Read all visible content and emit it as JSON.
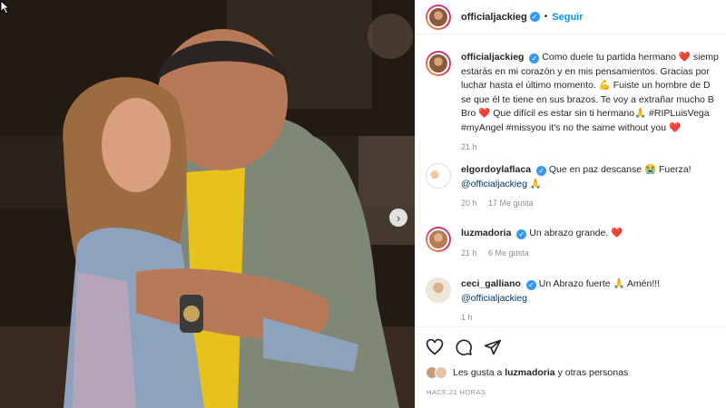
{
  "post": {
    "author": "officialjackieg",
    "follow_label": "Seguir",
    "separator": "•"
  },
  "caption": {
    "username": "officialjackieg",
    "lines": [
      "Como duele tu partida hermano ❤️ siemp",
      "estarás en mi corazón y en mis pensamientos. Gracias por",
      "luchar hasta el último momento. 💪 Fuiste un hombre de D",
      "se que él te tiene en sus brazos. Te voy a extrañar mucho B",
      "Bro ❤️ Que difícil es estar sin ti hermano🙏 #RIPLuisVega",
      "#myAngel #missyou it's no the same without you ❤️"
    ],
    "time": "21 h"
  },
  "comments": [
    {
      "username": "elgordoylaflaca",
      "text": "Que en paz descanse 😭 Fuerza!",
      "mention": "@officialjackieg",
      "after_mention": "🙏",
      "time": "20 h",
      "likes": "17 Me gusta"
    },
    {
      "username": "luzmadoria",
      "text": "Un abrazo grande. ❤️",
      "time": "21 h",
      "likes": "6 Me gusta"
    },
    {
      "username": "ceci_galliano",
      "text": "Un Abrazo fuerte 🙏 Amén!!!",
      "mention": "@officialjackieg",
      "time": "1 h"
    }
  ],
  "actions": {
    "icons": [
      "heart-icon",
      "comment-icon",
      "share-icon"
    ],
    "likes_prefix": "Les gusta a",
    "likes_user": "luzmadoria",
    "likes_suffix": "y otras personas",
    "time_ago": "HACE 21 HORAS"
  },
  "colors": {
    "accent": "#0095f6",
    "verified": "#3897f0",
    "mention": "#00376b",
    "heart": "#e0112f",
    "muted": "#8e8e8e"
  }
}
